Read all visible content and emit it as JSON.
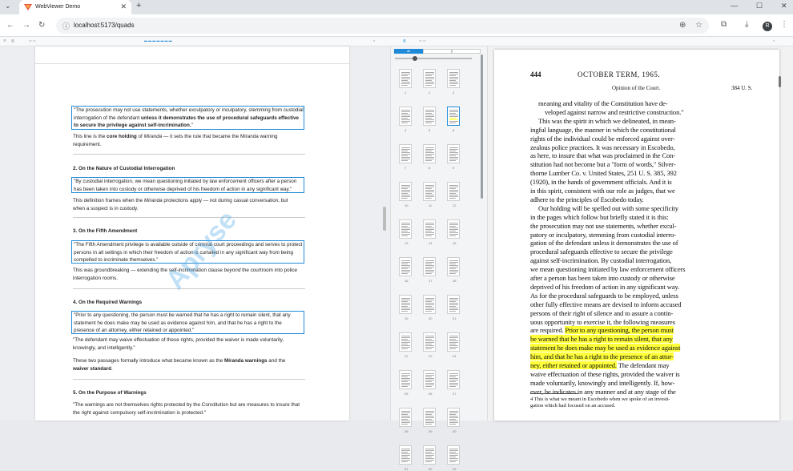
{
  "browser": {
    "tab_title": "WebViewer Demo",
    "url": "localhost:5173/quads",
    "new_tab_symbol": "+",
    "profile_initial": "R"
  },
  "left_doc": {
    "blocks": [
      {
        "kind": "hl",
        "text_a": "\"The prosecution may not use statements, whether exculpatory or inculpatory, stemming from custodial interrogation of the defendant ",
        "text_b": "unless it demonstrates the use of procedural safeguards effective to secure the privilege against self-incrimination.",
        "text_c": "\""
      },
      {
        "kind": "p",
        "text_a": "This line is the ",
        "bold": "core holding",
        "text_b": " of ",
        "ital": "Miranda",
        "text_c": " — it sets the rule that became the Miranda warning requirement."
      },
      {
        "kind": "h",
        "text": "2. On the Nature of Custodial Interrogation"
      },
      {
        "kind": "hl",
        "text_a": "\"By custodial interrogation, we mean questioning initiated by law enforcement officers after a person has been taken into custody or otherwise deprived of his freedom of action in any significant way.\"",
        "text_b": "",
        "text_c": ""
      },
      {
        "kind": "p",
        "text_a": "This definition frames when the ",
        "ital": "Miranda",
        "text_b": " protections apply — not during casual conversation, but when a suspect is in custody.",
        "bold": "",
        "text_c": ""
      },
      {
        "kind": "h",
        "text": "3. On the Fifth Amendment"
      },
      {
        "kind": "hl",
        "text_a": "\"The Fifth Amendment privilege is available outside of criminal court proceedings and serves to protect persons in all settings in which their freedom of action is curtailed in any significant way from being compelled to incriminate themselves.\"",
        "text_b": "",
        "text_c": ""
      },
      {
        "kind": "p",
        "text_a": "This was groundbreaking — extending the self-incrimination clause ",
        "ital": "beyond",
        "text_b": " the courtroom into police interrogation rooms.",
        "bold": "",
        "text_c": ""
      },
      {
        "kind": "h",
        "text": "4. On the Required Warnings"
      },
      {
        "kind": "hl",
        "text_a": "\"Prior to any questioning, the person must be warned that he has a right to remain silent, that any statement he does make may be used as evidence against him, and that he has a right to the presence of an attorney, either retained or appointed.\"",
        "text_b": "",
        "text_c": ""
      },
      {
        "kind": "p",
        "text_a": "\"The defendant may waive effectuation of these rights, provided the waiver is made voluntarily, knowingly, and intelligently.\"",
        "text_b": "",
        "text_c": "",
        "bold": "",
        "ital": ""
      },
      {
        "kind": "p",
        "text_a": "These two passages formally introduce what became known as the ",
        "bold": "Miranda warnings",
        "text_b": " and the ",
        "ital": "",
        "text_c": ""
      },
      {
        "kind": "h",
        "text": "5. On the Purpose of Warnings"
      },
      {
        "kind": "p",
        "text_a": "\"The warnings are not themselves rights protected by the Constitution but are measures to insure that the right against compulsory self-incrimination is protected.\"",
        "text_b": "",
        "text_c": "",
        "bold": "",
        "ital": ""
      }
    ],
    "waiver_bold": "waiver standard",
    "watermark": "Apryse"
  },
  "thumbnails": {
    "tabs": [
      "all",
      "",
      ""
    ],
    "selected_page": 6,
    "page_count": 33
  },
  "right_doc": {
    "page_number": "444",
    "term": "OCTOBER TERM, 1965.",
    "opinion": "Opinion of the Court.",
    "cite": "384 U. S.",
    "lines": [
      [
        "meaning and vitality of the Constitution have de-",
        ""
      ],
      [
        "veloped against narrow and restrictive construction.\"",
        ""
      ],
      [
        "This was the spirit in which we delineated, in mean-",
        ""
      ],
      [
        "ingful language, the manner in which the constitutional",
        ""
      ],
      [
        "rights of the individual could be enforced against over-",
        ""
      ],
      [
        "zealous police practices.  It was necessary in Escobedo,",
        ""
      ],
      [
        "as here, to insure that what was proclaimed in the Con-",
        ""
      ],
      [
        "stitution had not become but a \"form of words,\" Silver-",
        ""
      ],
      [
        "thorne Lumber Co. v. United States, 251 U. S. 385, 392",
        ""
      ],
      [
        "(1920), in the hands of government officials.  And it is",
        ""
      ],
      [
        "in this spirit, consistent with our role as judges, that we",
        ""
      ],
      [
        "adhere to the principles of Escobedo today.",
        ""
      ],
      [
        "Our holding will be spelled out with some specificity",
        ""
      ],
      [
        "in the pages which follow but briefly stated it is this:",
        ""
      ],
      [
        "the prosecution may not use statements, whether excul-",
        ""
      ],
      [
        "patory or inculpatory, stemming from custodial interro-",
        ""
      ],
      [
        "gation of the defendant unless it demonstrates the use of",
        ""
      ],
      [
        "procedural safeguards effective to secure the privilege",
        ""
      ],
      [
        "against self-incrimination.  By custodial interrogation,",
        ""
      ],
      [
        "we mean questioning initiated by law enforcement officers",
        ""
      ],
      [
        "after a person has been taken into custody or otherwise",
        ""
      ],
      [
        "deprived of his freedom of action in any significant way.",
        ""
      ],
      [
        "As for the procedural safeguards to be employed, unless",
        ""
      ],
      [
        "other fully effective means are devised to inform accused",
        ""
      ],
      [
        "persons of their right of silence and to assure a contin-",
        ""
      ],
      [
        "uous opportunity to exercise it, the following measures",
        ""
      ],
      [
        "are required.  ",
        "Prior to any questioning, the person must"
      ],
      [
        "",
        "be warned that he has a right to remain silent, that any"
      ],
      [
        "",
        "statement he does make may be used as evidence against"
      ],
      [
        "",
        "him, and that he has a right to the presence of an attor-"
      ],
      [
        "",
        "ney, either retained or appointed.",
        "  The defendant may"
      ],
      [
        "waive effectuation of these rights, provided the waiver is",
        ""
      ],
      [
        "made voluntarily, knowingly and intelligently.  If, how-",
        ""
      ],
      [
        "ever, he indicates in any manner and at any stage of the",
        ""
      ]
    ],
    "footnote": "4 This is what we meant in Escobedo when we spoke of an investi-",
    "footnote2": "gation which had focused on an accused."
  },
  "colors": {
    "highlight": "#ffff3a",
    "quad_border": "#1f8ad8",
    "accent": "#1f8ad8"
  }
}
